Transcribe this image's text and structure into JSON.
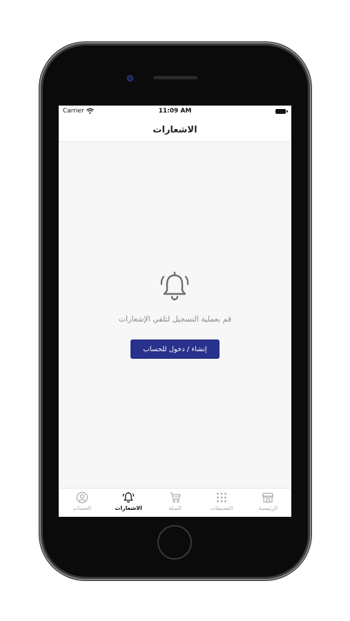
{
  "status": {
    "carrier": "Carrier",
    "time": "11:09 AM"
  },
  "nav": {
    "title": "الاشعارات"
  },
  "empty_state": {
    "icon": "bell-icon",
    "message": "قم بعملية التسجيل لتلقي الإشعارات",
    "button_label": "إنشاء / دخول للحساب"
  },
  "tabs": [
    {
      "label": "الحساب",
      "icon": "account-icon",
      "active": false
    },
    {
      "label": "الاشعارات",
      "icon": "bell-icon",
      "active": true
    },
    {
      "label": "السلة",
      "icon": "cart-icon",
      "active": false
    },
    {
      "label": "التصنيفات",
      "icon": "grid-icon",
      "active": false
    },
    {
      "label": "الرئيسية",
      "icon": "store-icon",
      "active": false
    }
  ],
  "colors": {
    "accent": "#28318c",
    "screen_bg": "#f7f7f7"
  }
}
